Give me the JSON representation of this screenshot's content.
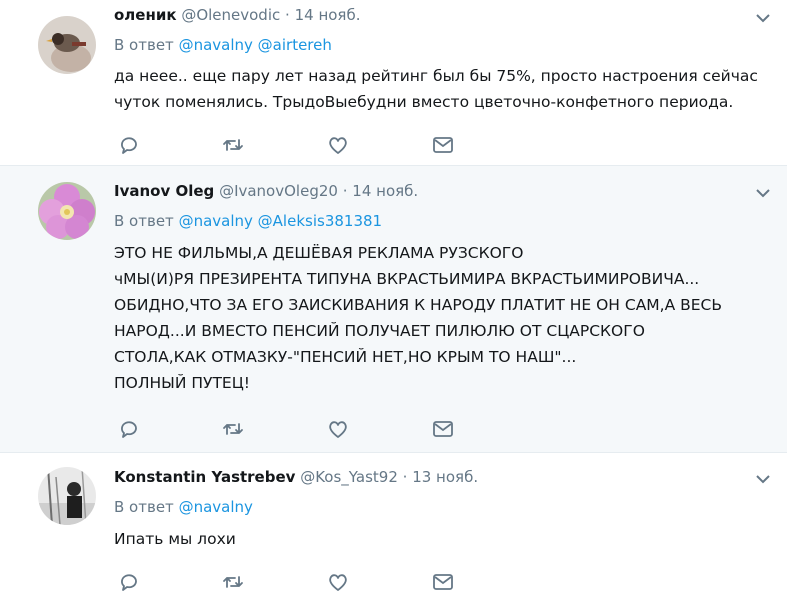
{
  "tweets": [
    {
      "name": "оленик",
      "handle": "@Olenevodic",
      "dot": "·",
      "time": "14 нояб.",
      "reply_prefix": "В ответ",
      "mentions": [
        "@navalny",
        "@airtereh"
      ],
      "text": "да неее.. еще пару лет назад рейтинг был бы 75%, просто настроения сейчас\nчуток поменялись. ТрыдоВыебудни вместо цветочно-конфетного периода."
    },
    {
      "name": "Ivanov Oleg",
      "handle": "@IvanovOleg20",
      "dot": "·",
      "time": "14 нояб.",
      "reply_prefix": "В ответ",
      "mentions": [
        "@navalny",
        "@Aleksis381381"
      ],
      "text": "ЭТО НЕ ФИЛЬМЫ,А ДЕШЁВАЯ РЕКЛАМА РУЗСКОГО\nчМЫ(И)РЯ ПРЕЗИРЕНТА ТИПУНА ВКРАСТЬИМИРА ВКРАСТЬИМИРОВИЧА...\nОБИДНО,ЧТО ЗА ЕГО ЗАИСКИВАНИЯ К НАРОДУ ПЛАТИТ НЕ ОН САМ,А ВЕСЬ\nНАРОД...И ВМЕСТО ПЕНСИЙ ПОЛУЧАЕТ ПИЛЮЛЮ ОТ СЦАРСКОГО\nСТОЛА,КАК ОТМАЗКУ-\"ПЕНСИЙ НЕТ,НО КРЫМ ТО НАШ\"...\nПОЛНЫЙ ПУТЕЦ!"
    },
    {
      "name": "Konstantin Yastrebev",
      "handle": "@Kos_Yast92",
      "dot": "·",
      "time": "13 нояб.",
      "reply_prefix": "В ответ",
      "mentions": [
        "@navalny"
      ],
      "text": "Ипать мы лохи"
    }
  ],
  "icons": {
    "reply": "reply-icon",
    "retweet": "retweet-icon",
    "like": "heart-icon",
    "dm": "envelope-icon",
    "caret": "chevron-down-icon"
  },
  "colors": {
    "link": "#1b95e0",
    "muted": "#657786",
    "highlight_bg": "#f5f8fa",
    "divider": "#e6ecf0"
  }
}
